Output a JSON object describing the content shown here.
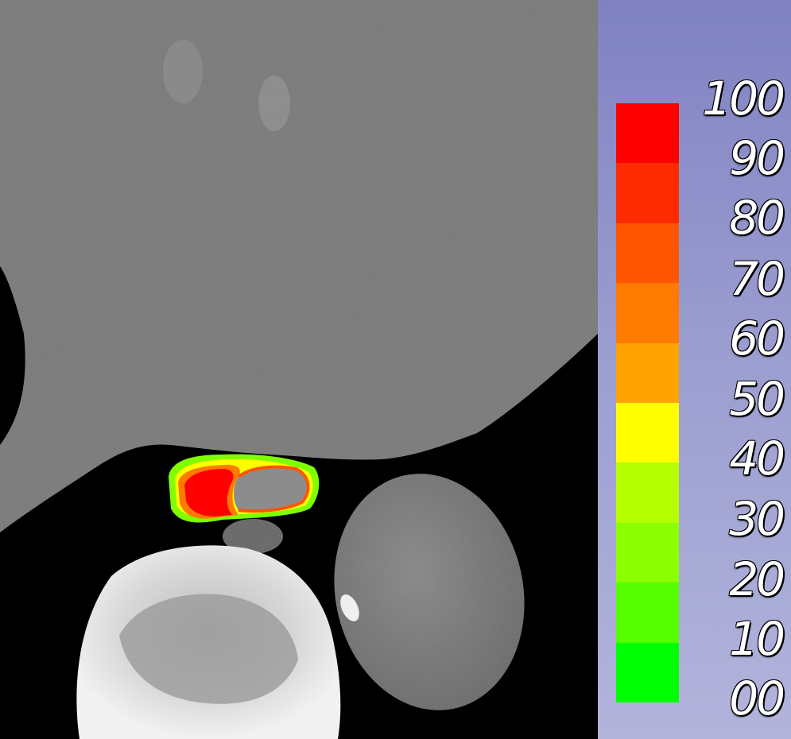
{
  "legend": {
    "labels": [
      "100",
      "90",
      "80",
      "70",
      "60",
      "50",
      "40",
      "30",
      "20",
      "10",
      "00"
    ],
    "colors": [
      "#ff0000",
      "#ff2a00",
      "#ff5500",
      "#ff7a00",
      "#ffa300",
      "#ffff00",
      "#b4ff00",
      "#8cff00",
      "#55ff00",
      "#00ff00"
    ]
  }
}
